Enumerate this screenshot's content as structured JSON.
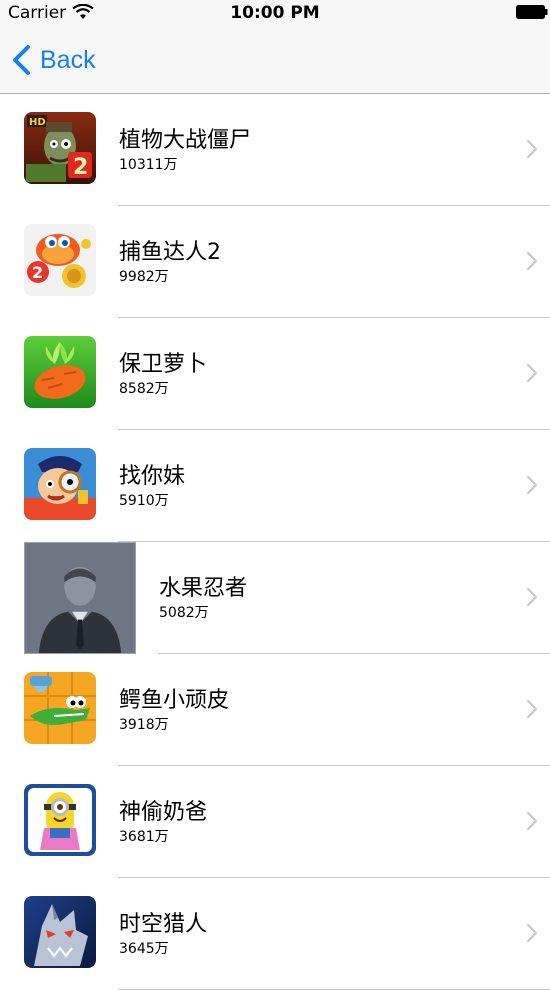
{
  "status_bar": {
    "carrier": "Carrier",
    "time": "10:00 PM"
  },
  "nav": {
    "back_label": "Back"
  },
  "apps": [
    {
      "name": "植物大战僵尸",
      "downloads": "10311万",
      "icon": "plants-vs-zombies-icon"
    },
    {
      "name": "捕鱼达人2",
      "downloads": "9982万",
      "icon": "fishing-joy-icon"
    },
    {
      "name": "保卫萝卜",
      "downloads": "8582万",
      "icon": "carrot-defense-icon"
    },
    {
      "name": "找你妹",
      "downloads": "5910万",
      "icon": "find-sister-icon"
    },
    {
      "name": "水果忍者",
      "downloads": "5082万",
      "icon": "person-placeholder-icon"
    },
    {
      "name": "鳄鱼小顽皮",
      "downloads": "3918万",
      "icon": "crocodile-icon"
    },
    {
      "name": "神偷奶爸",
      "downloads": "3681万",
      "icon": "minion-icon"
    },
    {
      "name": "时空猎人",
      "downloads": "3645万",
      "icon": "time-hunter-icon"
    }
  ],
  "colors": {
    "tint": "#147efb",
    "separator": "#c8c7cc",
    "bar_background": "#f7f7f7"
  }
}
